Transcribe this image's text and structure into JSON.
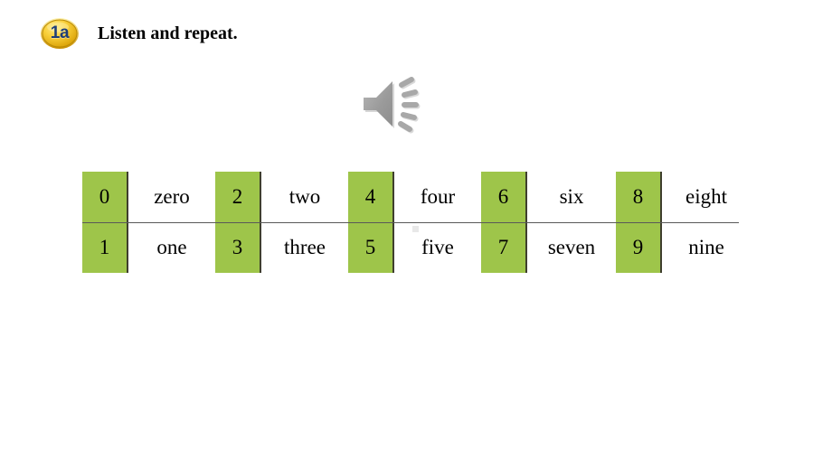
{
  "header": {
    "badge_label": "1a",
    "badge_color": "#f2c21b",
    "title": "Listen and repeat."
  },
  "media": {
    "speaker_icon": "speaker-icon",
    "speaker_color": "#9e9e9e"
  },
  "table": {
    "cell_green": "#9ec54a",
    "border_color": "#3f3f2e",
    "separator_color": "#595959",
    "rows": [
      [
        {
          "digit": "0",
          "word": "zero"
        },
        {
          "digit": "2",
          "word": "two"
        },
        {
          "digit": "4",
          "word": "four"
        },
        {
          "digit": "6",
          "word": "six"
        },
        {
          "digit": "8",
          "word": "eight"
        }
      ],
      [
        {
          "digit": "1",
          "word": "one"
        },
        {
          "digit": "3",
          "word": "three"
        },
        {
          "digit": "5",
          "word": "five"
        },
        {
          "digit": "7",
          "word": "seven"
        },
        {
          "digit": "9",
          "word": "nine"
        }
      ]
    ]
  }
}
